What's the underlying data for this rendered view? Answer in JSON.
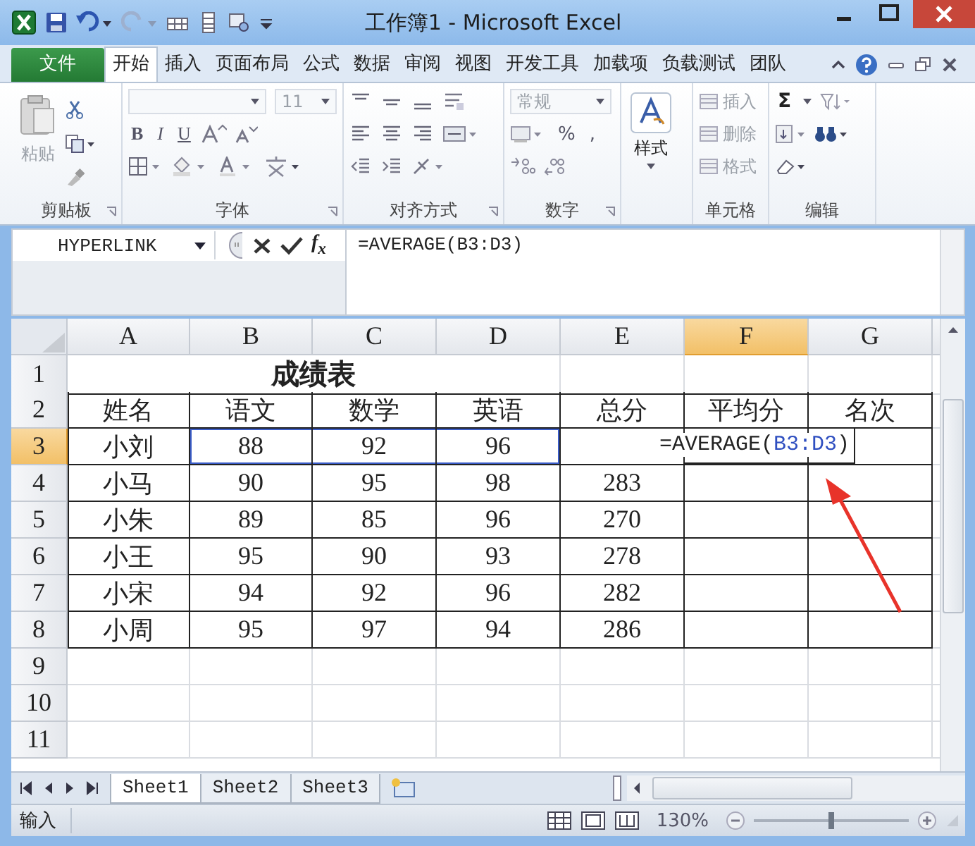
{
  "window": {
    "title": "工作簿1 - Microsoft Excel"
  },
  "ribbon_tabs": [
    {
      "label": "文件",
      "kind": "file",
      "selected": false
    },
    {
      "label": "开始",
      "kind": "tab",
      "selected": true
    },
    {
      "label": "插入",
      "kind": "tab",
      "selected": false
    },
    {
      "label": "页面布局",
      "kind": "tab",
      "selected": false
    },
    {
      "label": "公式",
      "kind": "tab",
      "selected": false
    },
    {
      "label": "数据",
      "kind": "tab",
      "selected": false
    },
    {
      "label": "审阅",
      "kind": "tab",
      "selected": false
    },
    {
      "label": "视图",
      "kind": "tab",
      "selected": false
    },
    {
      "label": "开发工具",
      "kind": "tab",
      "selected": false
    },
    {
      "label": "加载项",
      "kind": "tab",
      "selected": false
    },
    {
      "label": "负载测试",
      "kind": "tab",
      "selected": false
    },
    {
      "label": "团队",
      "kind": "tab",
      "selected": false
    }
  ],
  "ribbon": {
    "clipboard": {
      "label": "剪贴板",
      "paste": "粘贴"
    },
    "font": {
      "label": "字体",
      "size": "11",
      "bold": "B",
      "italic": "I",
      "underline": "U"
    },
    "alignment": {
      "label": "对齐方式"
    },
    "number": {
      "label": "数字",
      "format": {
        "value": "常规",
        "disabled": true
      },
      "percent": "%",
      "comma": ","
    },
    "styles": {
      "button": "样式"
    },
    "cells": {
      "label": "单元格",
      "buttons": [
        {
          "label": "插入",
          "disabled": true
        },
        {
          "label": "删除",
          "disabled": true
        },
        {
          "label": "格式",
          "disabled": true
        }
      ]
    },
    "editing": {
      "label": "编辑",
      "sum": "Σ"
    }
  },
  "formula_bar": {
    "name_box": "HYPERLINK",
    "fx": "f$_{x}$",
    "formula": "=AVERAGE(B3:D3)"
  },
  "columns": [
    {
      "label": "A",
      "selected": false
    },
    {
      "label": "B",
      "selected": false
    },
    {
      "label": "C",
      "selected": false
    },
    {
      "label": "D",
      "selected": false
    },
    {
      "label": "E",
      "selected": false
    },
    {
      "label": "F",
      "selected": true
    },
    {
      "label": "G",
      "selected": false
    }
  ],
  "rows": [
    {
      "header": "1",
      "selected": false,
      "bordered": false,
      "cells": [
        {
          "text": "成绩表",
          "kind": "title"
        }
      ]
    },
    {
      "header": "2",
      "selected": false,
      "bordered": true,
      "cells": [
        {
          "text": "姓名"
        },
        {
          "text": "语文"
        },
        {
          "text": "数学"
        },
        {
          "text": "英语"
        },
        {
          "text": "总分"
        },
        {
          "text": "平均分"
        },
        {
          "text": "名次"
        }
      ]
    },
    {
      "header": "3",
      "selected": true,
      "bordered": true,
      "cells": [
        {
          "text": "小刘"
        },
        {
          "text": "88",
          "ref": true
        },
        {
          "text": "92",
          "ref": true
        },
        {
          "text": "96",
          "ref": true
        },
        {
          "kind": "blank"
        },
        {
          "kind": "editor",
          "parts": [
            {
              "text": "=AVERAGE(",
              "kind": "plain"
            },
            {
              "text": "B3:D3",
              "kind": "ref"
            },
            {
              "text": ")",
              "kind": "plain"
            }
          ]
        }
      ]
    },
    {
      "header": "4",
      "selected": false,
      "bordered": true,
      "cells": [
        {
          "text": "小马"
        },
        {
          "text": "90"
        },
        {
          "text": "95"
        },
        {
          "text": "98"
        },
        {
          "text": "283"
        }
      ]
    },
    {
      "header": "5",
      "selected": false,
      "bordered": true,
      "cells": [
        {
          "text": "小朱"
        },
        {
          "text": "89"
        },
        {
          "text": "85"
        },
        {
          "text": "96"
        },
        {
          "text": "270"
        }
      ]
    },
    {
      "header": "6",
      "selected": false,
      "bordered": true,
      "cells": [
        {
          "text": "小王"
        },
        {
          "text": "95"
        },
        {
          "text": "90"
        },
        {
          "text": "93"
        },
        {
          "text": "278"
        }
      ]
    },
    {
      "header": "7",
      "selected": false,
      "bordered": true,
      "cells": [
        {
          "text": "小宋"
        },
        {
          "text": "94"
        },
        {
          "text": "92"
        },
        {
          "text": "96"
        },
        {
          "text": "282"
        }
      ]
    },
    {
      "header": "8",
      "selected": false,
      "bordered": true,
      "cells": [
        {
          "text": "小周"
        },
        {
          "text": "95"
        },
        {
          "text": "97"
        },
        {
          "text": "94"
        },
        {
          "text": "286"
        }
      ]
    },
    {
      "header": "9",
      "selected": false,
      "bordered": false,
      "cells": []
    },
    {
      "header": "10",
      "selected": false,
      "bordered": false,
      "cells": []
    },
    {
      "header": "11",
      "selected": false,
      "bordered": false,
      "cells": []
    }
  ],
  "sheet_tabs": [
    {
      "label": "Sheet1",
      "selected": true
    },
    {
      "label": "Sheet2",
      "selected": false
    },
    {
      "label": "Sheet3",
      "selected": false
    }
  ],
  "status_bar": {
    "mode": "输入",
    "zoom": "130%",
    "zoom_slider": {
      "level": 0.5
    }
  }
}
